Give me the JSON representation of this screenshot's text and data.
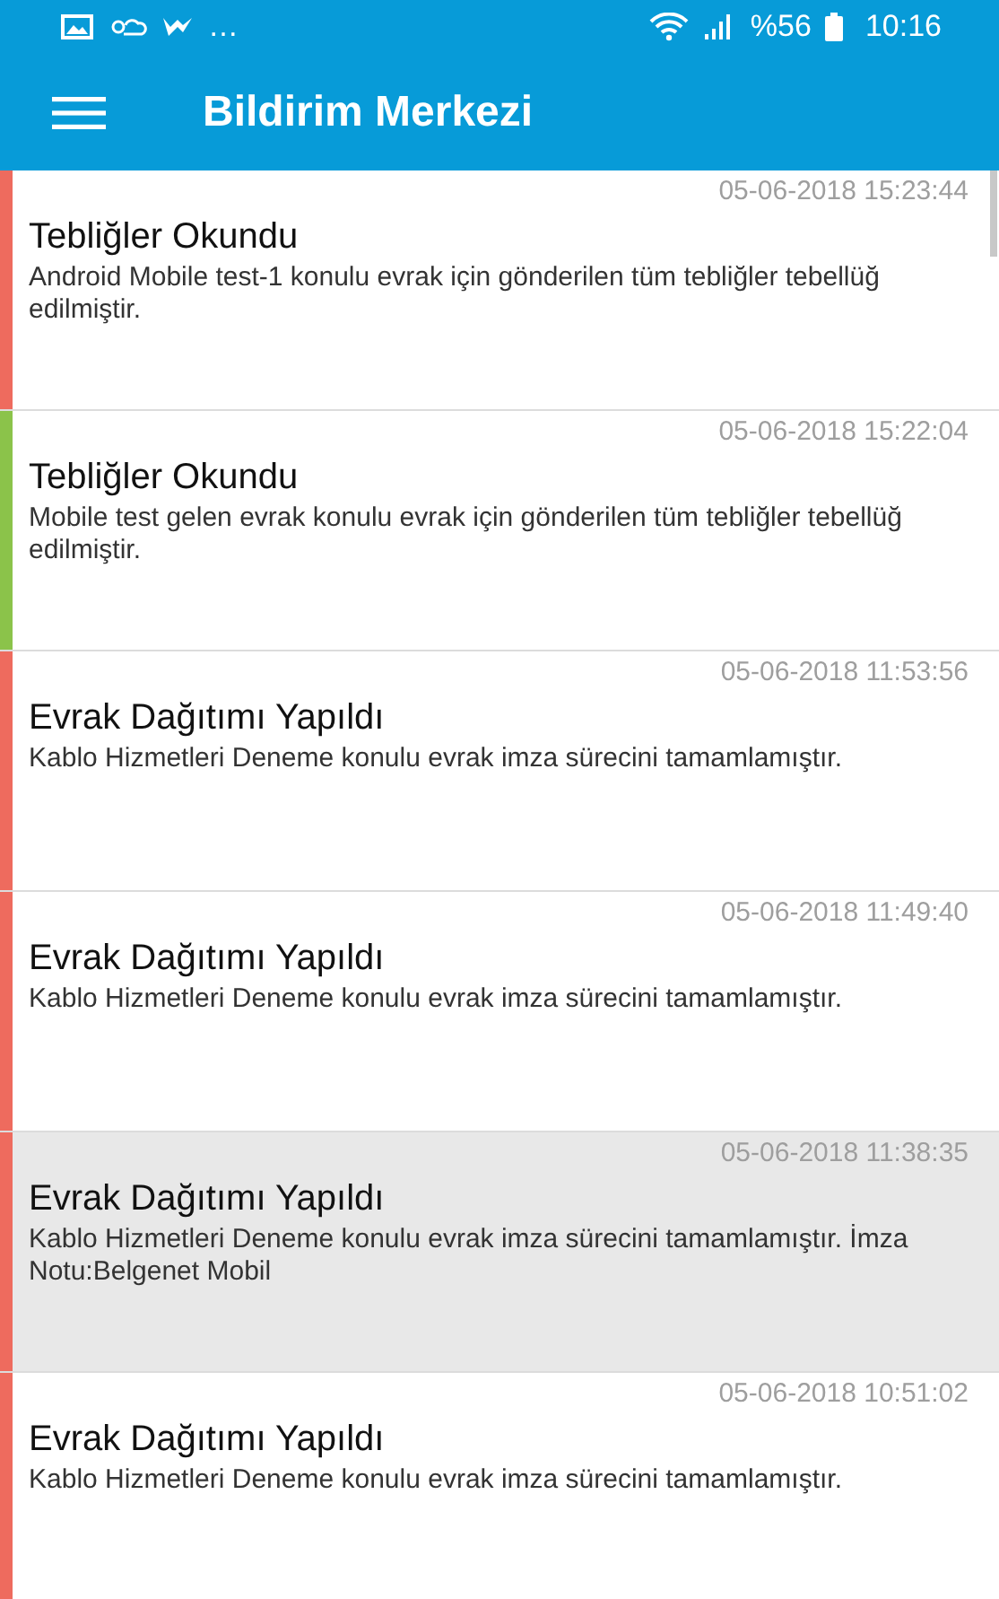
{
  "status_bar": {
    "overflow": "…",
    "battery": "%56",
    "time": "10:16"
  },
  "app_bar": {
    "title": "Bildirim Merkezi"
  },
  "notifications": [
    {
      "date": "05-06-2018 15:23:44",
      "title": "Tebliğler Okundu",
      "message": "Android Mobile test-1 konulu evrak için gönderilen tüm tebliğler tebellüğ edilmiştir.",
      "color": "#ee6b5e",
      "selected": false
    },
    {
      "date": "05-06-2018 15:22:04",
      "title": "Tebliğler Okundu",
      "message": "Mobile test gelen evrak konulu evrak için gönderilen tüm tebliğler tebellüğ edilmiştir.",
      "color": "#8bc34a",
      "selected": false
    },
    {
      "date": "05-06-2018 11:53:56",
      "title": "Evrak Dağıtımı Yapıldı",
      "message": "Kablo Hizmetleri Deneme konulu evrak imza sürecini tamamlamıştır.",
      "color": "#ee6b5e",
      "selected": false
    },
    {
      "date": "05-06-2018 11:49:40",
      "title": "Evrak Dağıtımı Yapıldı",
      "message": "Kablo Hizmetleri Deneme konulu evrak imza sürecini tamamlamıştır.",
      "color": "#ee6b5e",
      "selected": false
    },
    {
      "date": "05-06-2018 11:38:35",
      "title": "Evrak Dağıtımı Yapıldı",
      "message": "Kablo Hizmetleri Deneme konulu evrak imza sürecini tamamlamıştır. İmza Notu:Belgenet Mobil",
      "color": "#ee6b5e",
      "selected": true
    },
    {
      "date": "05-06-2018 10:51:02",
      "title": "Evrak Dağıtımı Yapıldı",
      "message": "Kablo Hizmetleri Deneme konulu evrak imza sürecini tamamlamıştır.",
      "color": "#ee6b5e",
      "selected": false
    }
  ]
}
